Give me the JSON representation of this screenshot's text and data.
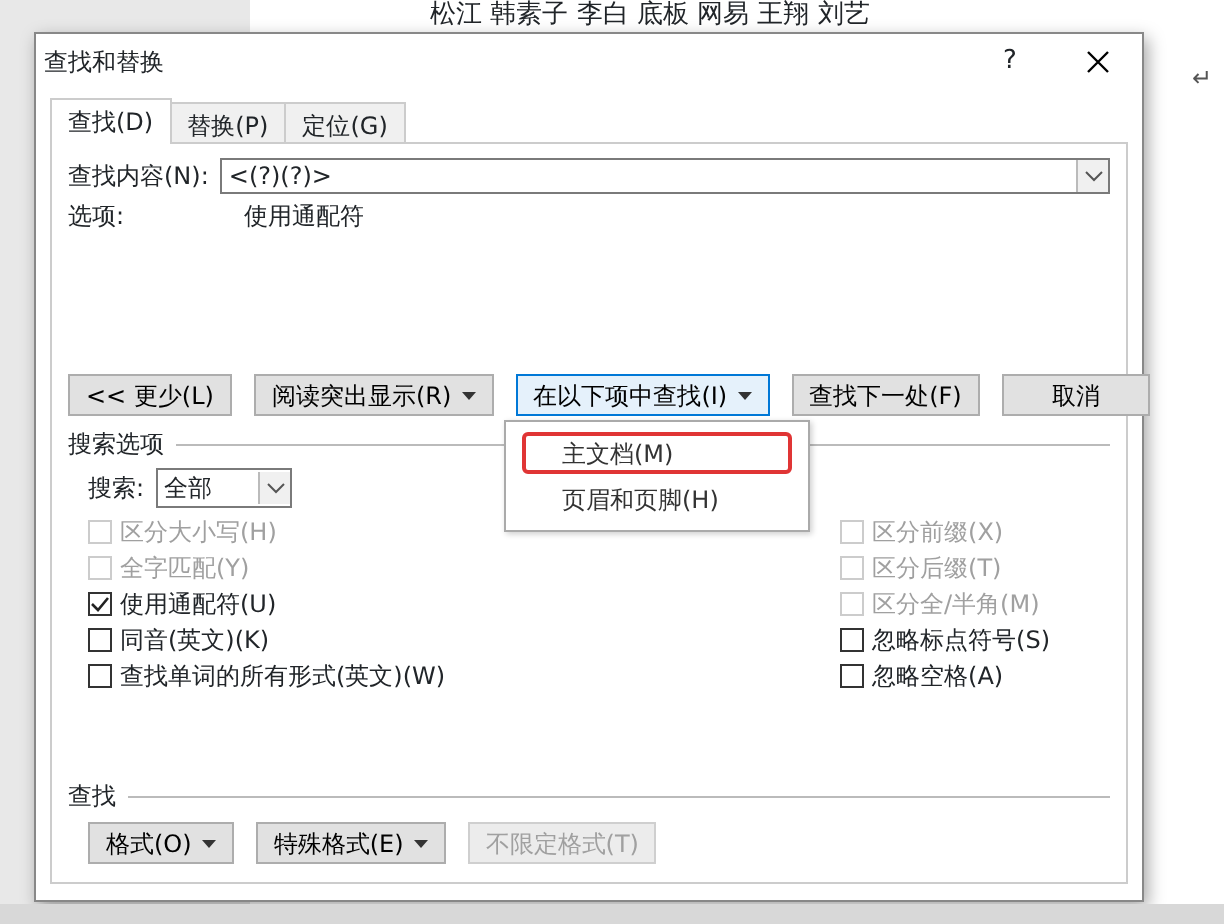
{
  "document": {
    "text": "松江  韩素子  李白  底板  网易  王翔  刘艺",
    "mark": "↵"
  },
  "dialog": {
    "title": "查找和替换",
    "help": "?",
    "tabs": [
      {
        "label": "查找(D)",
        "selected": true
      },
      {
        "label": "替换(P)",
        "selected": false
      },
      {
        "label": "定位(G)",
        "selected": false
      }
    ],
    "find": {
      "label": "查找内容(N):",
      "value": "<(?)(?)>"
    },
    "options": {
      "label": "选项:",
      "value": "使用通配符"
    },
    "buttons": [
      {
        "label": "<< 更少(L)",
        "dropdown": false,
        "active": false
      },
      {
        "label": "阅读突出显示(R)",
        "dropdown": true,
        "active": false
      },
      {
        "label": "在以下项中查找(I)",
        "dropdown": true,
        "active": true
      },
      {
        "label": "查找下一处(F)",
        "dropdown": false,
        "active": false
      },
      {
        "label": "取消",
        "dropdown": false,
        "active": false
      }
    ],
    "menu": {
      "items": [
        {
          "label": "主文档(M)",
          "marked": true
        },
        {
          "label": "页眉和页脚(H)",
          "marked": false
        }
      ]
    },
    "search_options": {
      "title": "搜索选项",
      "search_label": "搜索:",
      "search_value": "全部",
      "left": [
        {
          "label": "区分大小写(H)",
          "checked": false,
          "disabled": true
        },
        {
          "label": "全字匹配(Y)",
          "checked": false,
          "disabled": true
        },
        {
          "label": "使用通配符(U)",
          "checked": true,
          "disabled": false
        },
        {
          "label": "同音(英文)(K)",
          "checked": false,
          "disabled": false
        },
        {
          "label": "查找单词的所有形式(英文)(W)",
          "checked": false,
          "disabled": false
        }
      ],
      "right": [
        {
          "label": "区分前缀(X)",
          "checked": false,
          "disabled": true
        },
        {
          "label": "区分后缀(T)",
          "checked": false,
          "disabled": true
        },
        {
          "label": "区分全/半角(M)",
          "checked": false,
          "disabled": true
        },
        {
          "label": "忽略标点符号(S)",
          "checked": false,
          "disabled": false
        },
        {
          "label": "忽略空格(A)",
          "checked": false,
          "disabled": false
        }
      ]
    },
    "find_section": {
      "title": "查找",
      "buttons": [
        {
          "label": "格式(O)",
          "dropdown": true,
          "disabled": false
        },
        {
          "label": "特殊格式(E)",
          "dropdown": true,
          "disabled": false
        },
        {
          "label": "不限定格式(T)",
          "dropdown": false,
          "disabled": true
        }
      ]
    }
  }
}
